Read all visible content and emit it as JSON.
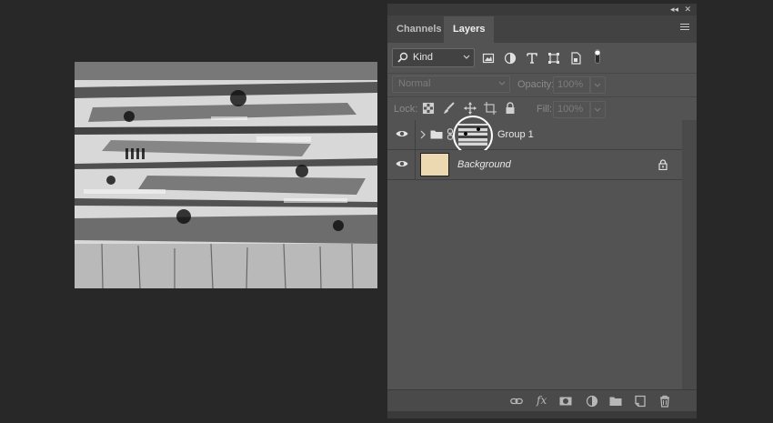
{
  "panel": {
    "tabs": [
      {
        "label": "Channels",
        "active": false
      },
      {
        "label": "Layers",
        "active": true
      }
    ],
    "filter": {
      "kind_label": "Kind"
    },
    "blend": {
      "mode": "Normal",
      "opacity_label": "Opacity:",
      "opacity_value": "100%",
      "lock_label": "Lock:",
      "fill_label": "Fill:",
      "fill_value": "100%"
    },
    "layers": [
      {
        "name": "Group 1",
        "type": "group",
        "visible": true,
        "has_mask": true,
        "italic": false
      },
      {
        "name": "Background",
        "type": "background",
        "visible": true,
        "locked": true,
        "italic": true,
        "thumb_color": "#ecd9b2"
      }
    ],
    "footer_icons": [
      "link-icon",
      "fx-icon",
      "mask-icon",
      "adjustment-icon",
      "folder-icon",
      "new-layer-icon",
      "trash-icon"
    ]
  },
  "colors": {
    "app_background": "#282828",
    "panel_background": "#535353",
    "highlight_ring": "#ffffff"
  }
}
